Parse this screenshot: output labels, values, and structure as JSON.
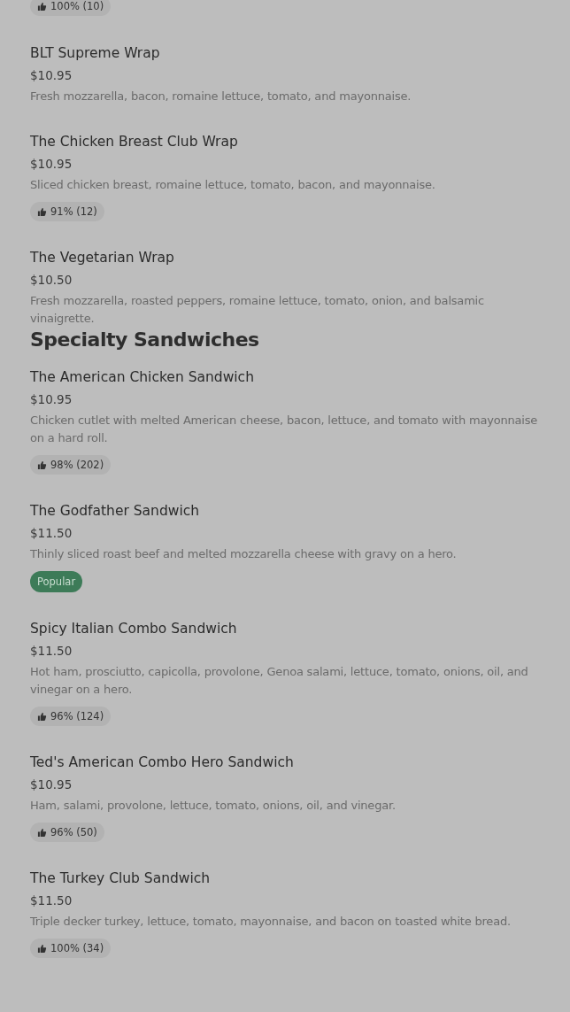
{
  "top_rating": "100% (10)",
  "sections": [
    {
      "items": [
        {
          "name": "BLT Supreme Wrap",
          "price": "$10.95",
          "description": "Fresh mozzarella, bacon, romaine lettuce, tomato, and mayonnaise."
        },
        {
          "name": "The Chicken Breast Club Wrap",
          "price": "$10.95",
          "description": "Sliced chicken breast, romaine lettuce, tomato, bacon, and mayonnaise.",
          "badge": {
            "kind": "rating",
            "text": "91% (12)"
          }
        },
        {
          "name": "The Vegetarian Wrap",
          "price": "$10.50",
          "description": "Fresh mozzarella, roasted peppers, romaine lettuce, tomato, onion, and balsamic vinaigrette."
        }
      ]
    },
    {
      "heading": "Specialty Sandwiches",
      "items": [
        {
          "name": "The American Chicken Sandwich",
          "price": "$10.95",
          "description": "Chicken cutlet with melted American cheese, bacon, lettuce, and tomato with mayonnaise on a hard roll.",
          "badge": {
            "kind": "rating",
            "text": "98% (202)"
          }
        },
        {
          "name": "The Godfather Sandwich",
          "price": "$11.50",
          "description": "Thinly sliced roast beef and melted mozzarella cheese with gravy on a hero.",
          "badge": {
            "kind": "popular",
            "text": "Popular"
          }
        },
        {
          "name": "Spicy Italian Combo Sandwich",
          "price": "$11.50",
          "description": "Hot ham, prosciutto, capicolla, provolone, Genoa salami, lettuce, tomato, onions, oil, and vinegar on a hero.",
          "badge": {
            "kind": "rating",
            "text": "96% (124)"
          }
        },
        {
          "name": "Ted's American Combo Hero Sandwich",
          "price": "$10.95",
          "description": "Ham, salami, provolone, lettuce, tomato, onions, oil, and vinegar.",
          "badge": {
            "kind": "rating",
            "text": "96% (50)"
          }
        },
        {
          "name": "The Turkey Club Sandwich",
          "price": "$11.50",
          "description": "Triple decker turkey, lettuce, tomato, mayonnaise, and bacon on toasted white bread.",
          "badge": {
            "kind": "rating",
            "text": "100% (34)"
          }
        }
      ]
    }
  ]
}
